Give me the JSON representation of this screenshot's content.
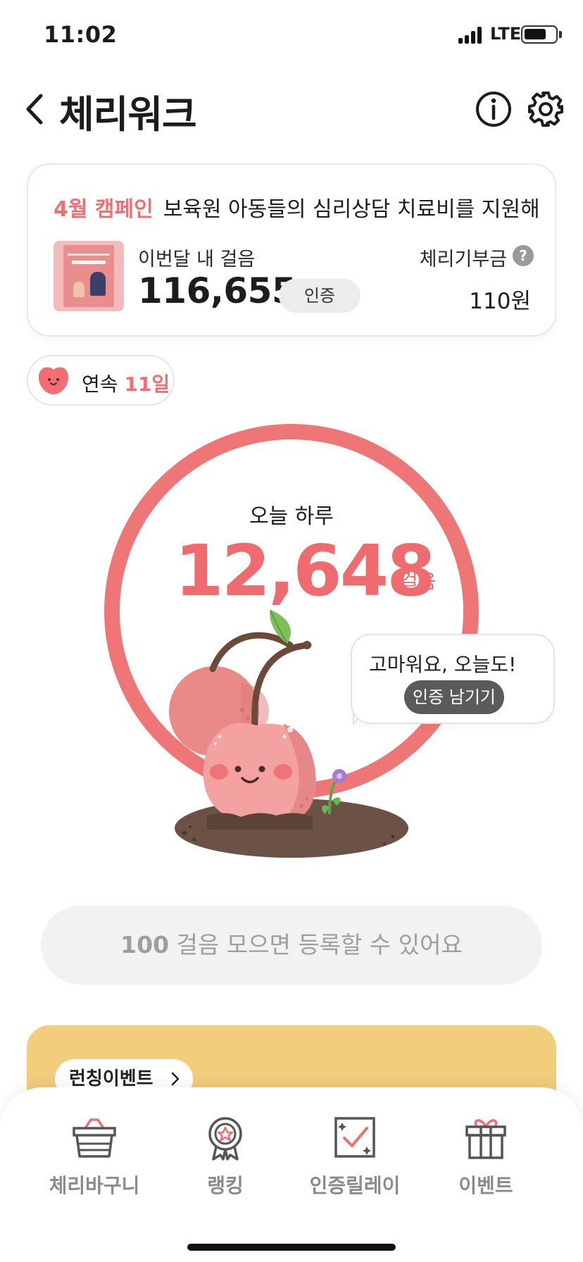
{
  "status_bar": {
    "time": "11:02",
    "network": "LTE"
  },
  "header": {
    "title": "체리워크"
  },
  "campaign": {
    "tag": "4월 캠페인",
    "description": "보육원 아동들의 심리상담 치료비를 지원해...",
    "month_steps_label": "이번달 내 걸음",
    "month_steps": "116,655",
    "verify_label": "인증",
    "donation_label": "체리기부금",
    "help_symbol": "?",
    "donation_amount": "110원"
  },
  "streak": {
    "prefix": "연속",
    "days": "11일"
  },
  "today": {
    "label": "오늘 하루",
    "steps": "12,648",
    "unit": "걸음"
  },
  "bubble": {
    "message": "고마워요, 오늘도!",
    "button": "인증 남기기"
  },
  "register": {
    "count": "100",
    "text": " 걸음 모으면 등록할 수 있어요"
  },
  "event_banner": {
    "chip_label": "런칭이벤트"
  },
  "tabs": [
    {
      "label": "체리바구니",
      "icon": "basket-icon"
    },
    {
      "label": "랭킹",
      "icon": "medal-icon"
    },
    {
      "label": "인증릴레이",
      "icon": "relay-check-icon"
    },
    {
      "label": "이벤트",
      "icon": "gift-icon"
    }
  ],
  "colors": {
    "accent": "#ef6f73",
    "ring": "#ef7677",
    "banner": "#f2cd7c",
    "tab_label": "#8a8a8a"
  }
}
